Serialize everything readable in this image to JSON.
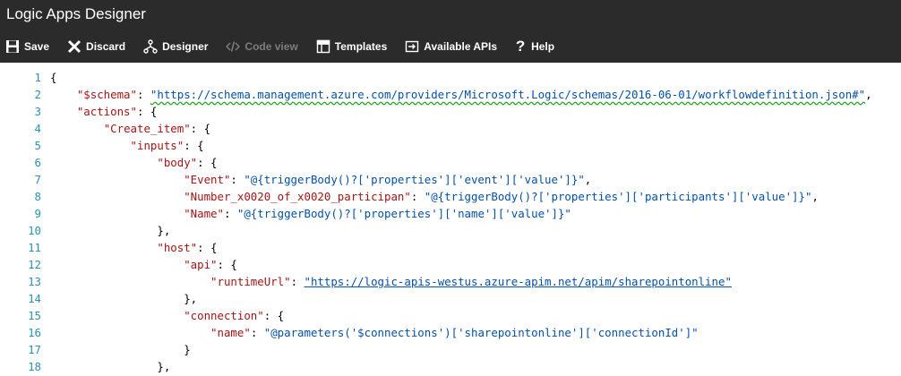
{
  "window": {
    "title": "Logic Apps Designer"
  },
  "toolbar": {
    "save": "Save",
    "discard": "Discard",
    "designer": "Designer",
    "code_view": "Code view",
    "templates": "Templates",
    "available_apis": "Available APIs",
    "help": "Help"
  },
  "editor": {
    "lines": [
      [
        {
          "t": "p",
          "v": "{"
        }
      ],
      [
        {
          "t": "p",
          "v": "    "
        },
        {
          "t": "k",
          "v": "\"$schema\""
        },
        {
          "t": "p",
          "v": ": "
        },
        {
          "t": "u",
          "v": "\"https://schema.management.azure.com/providers/Microsoft.Logic/schemas/2016-06-01/workflowdefinition.json#\""
        },
        {
          "t": "p",
          "v": ","
        }
      ],
      [
        {
          "t": "p",
          "v": "    "
        },
        {
          "t": "k",
          "v": "\"actions\""
        },
        {
          "t": "p",
          "v": ": {"
        }
      ],
      [
        {
          "t": "p",
          "v": "        "
        },
        {
          "t": "k",
          "v": "\"Create_item\""
        },
        {
          "t": "p",
          "v": ": {"
        }
      ],
      [
        {
          "t": "p",
          "v": "            "
        },
        {
          "t": "k",
          "v": "\"inputs\""
        },
        {
          "t": "p",
          "v": ": {"
        }
      ],
      [
        {
          "t": "p",
          "v": "                "
        },
        {
          "t": "k",
          "v": "\"body\""
        },
        {
          "t": "p",
          "v": ": {"
        }
      ],
      [
        {
          "t": "p",
          "v": "                    "
        },
        {
          "t": "k",
          "v": "\"Event\""
        },
        {
          "t": "p",
          "v": ": "
        },
        {
          "t": "s",
          "v": "\"@{triggerBody()?['properties']['event']['value']}\""
        },
        {
          "t": "p",
          "v": ","
        }
      ],
      [
        {
          "t": "p",
          "v": "                    "
        },
        {
          "t": "k",
          "v": "\"Number_x0020_of_x0020_participan\""
        },
        {
          "t": "p",
          "v": ": "
        },
        {
          "t": "s",
          "v": "\"@{triggerBody()?['properties']['participants']['value']}\""
        },
        {
          "t": "p",
          "v": ","
        }
      ],
      [
        {
          "t": "p",
          "v": "                    "
        },
        {
          "t": "k",
          "v": "\"Name\""
        },
        {
          "t": "p",
          "v": ": "
        },
        {
          "t": "s",
          "v": "\"@{triggerBody()?['properties']['name']['value']}\""
        }
      ],
      [
        {
          "t": "p",
          "v": "                },"
        }
      ],
      [
        {
          "t": "p",
          "v": "                "
        },
        {
          "t": "k",
          "v": "\"host\""
        },
        {
          "t": "p",
          "v": ": {"
        }
      ],
      [
        {
          "t": "p",
          "v": "                    "
        },
        {
          "t": "k",
          "v": "\"api\""
        },
        {
          "t": "p",
          "v": ": {"
        }
      ],
      [
        {
          "t": "p",
          "v": "                        "
        },
        {
          "t": "k",
          "v": "\"runtimeUrl\""
        },
        {
          "t": "p",
          "v": ": "
        },
        {
          "t": "u",
          "v": "\"https://logic-apis-westus.azure-apim.net/apim/sharepointonline\""
        }
      ],
      [
        {
          "t": "p",
          "v": "                    },"
        }
      ],
      [
        {
          "t": "p",
          "v": "                    "
        },
        {
          "t": "k",
          "v": "\"connection\""
        },
        {
          "t": "p",
          "v": ": {"
        }
      ],
      [
        {
          "t": "p",
          "v": "                        "
        },
        {
          "t": "k",
          "v": "\"name\""
        },
        {
          "t": "p",
          "v": ": "
        },
        {
          "t": "s",
          "v": "\"@parameters('$connections')['sharepointonline']['connectionId']\""
        }
      ],
      [
        {
          "t": "p",
          "v": "                    }"
        }
      ],
      [
        {
          "t": "p",
          "v": "                },"
        }
      ]
    ]
  },
  "colors": {
    "chrome_bg": "#2b2b2b",
    "line_number": "#2b91af",
    "key": "#a31515",
    "string": "#0451a5",
    "spellcheck": "#2aa12a"
  }
}
